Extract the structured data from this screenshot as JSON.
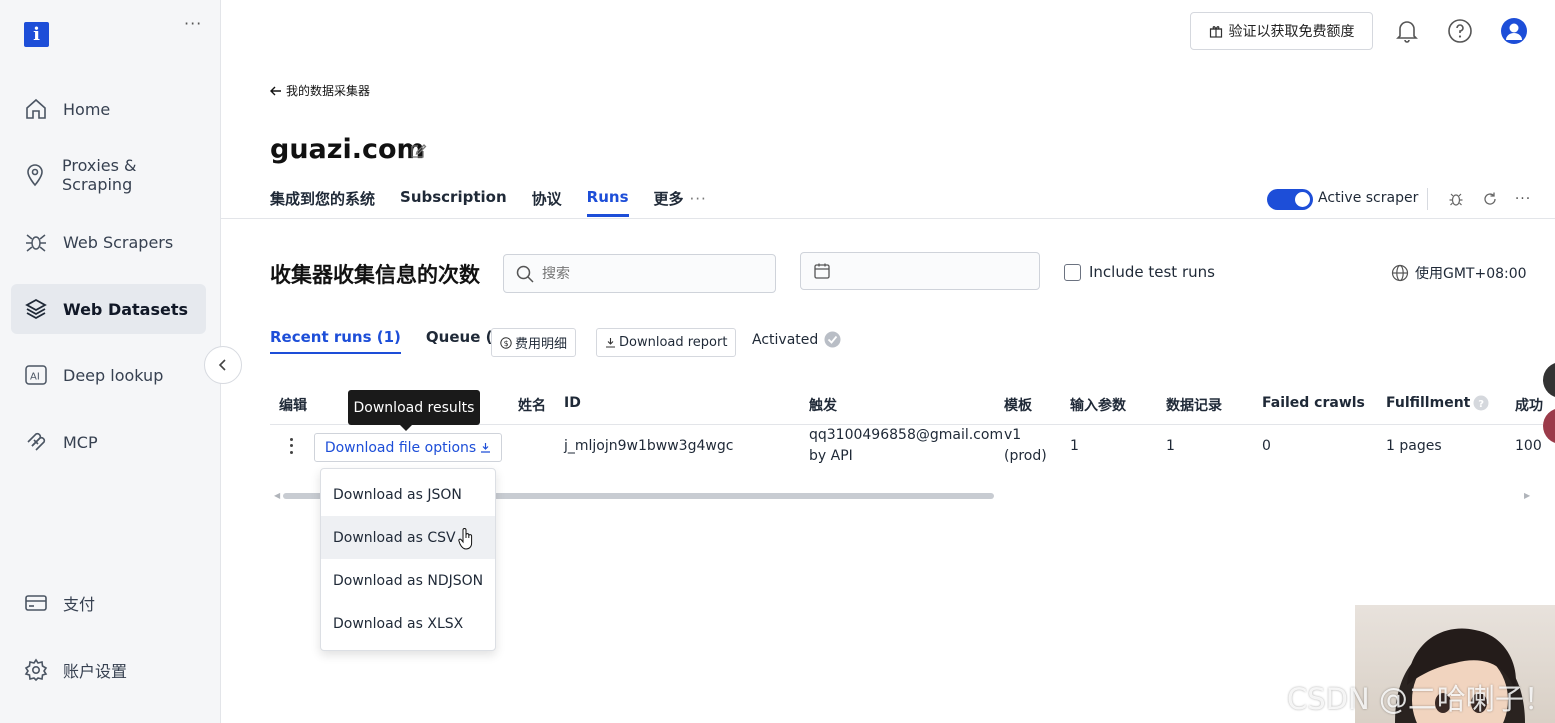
{
  "sidebar": {
    "logo": "i",
    "more": "···",
    "items": [
      {
        "label": "Home",
        "icon": "home-icon"
      },
      {
        "label": "Proxies & Scraping",
        "icon": "location-pin-icon"
      },
      {
        "label": "Web Scrapers",
        "icon": "spider-icon"
      },
      {
        "label": "Web Datasets",
        "icon": "layers-icon",
        "active": true
      },
      {
        "label": "Deep lookup",
        "icon": "ai-icon"
      },
      {
        "label": "MCP",
        "icon": "mcp-icon"
      }
    ],
    "bottom_items": [
      {
        "label": "支付",
        "icon": "card-icon"
      },
      {
        "label": "账户设置",
        "icon": "settings-icon"
      }
    ]
  },
  "header": {
    "verify_button": "验证以获取免费额度"
  },
  "breadcrumb": {
    "back_label": "我的数据采集器"
  },
  "page": {
    "title": "guazi.com"
  },
  "tabs": [
    {
      "label": "集成到您的系统"
    },
    {
      "label": "Subscription"
    },
    {
      "label": "协议"
    },
    {
      "label": "Runs",
      "active": true
    },
    {
      "label": "更多"
    }
  ],
  "scraper_status": {
    "label": "Active scraper",
    "enabled": true
  },
  "runs": {
    "title": "收集器收集信息的次数",
    "search_placeholder": "搜索",
    "include_test_runs": "Include test runs",
    "timezone": "使用GMT+08:00",
    "subtabs": [
      {
        "label": "Recent runs (1)",
        "active": true
      },
      {
        "label": "Queue (0)"
      }
    ],
    "cost_details": "费用明细",
    "download_report": "Download report",
    "activated": "Activated"
  },
  "table": {
    "headers": [
      "编辑",
      "姓名",
      "ID",
      "触发",
      "模板",
      "输入参数",
      "数据记录",
      "Failed crawls",
      "Fulfillment",
      "成功"
    ],
    "row": {
      "download_options": "Download file options",
      "id": "j_mljojn9w1bww3g4wgc",
      "trigger_email": "qq3100496858@gmail.com",
      "trigger_by": "by API",
      "template_version": "v1",
      "template_env": "(prod)",
      "input_params": "1",
      "records": "1",
      "failed_crawls": "0",
      "fulfillment": "1 pages",
      "success": "100"
    }
  },
  "tooltip": "Download results",
  "download_menu": [
    {
      "label": "Download as JSON"
    },
    {
      "label": "Download as CSV",
      "hover": true
    },
    {
      "label": "Download as NDJSON"
    },
    {
      "label": "Download as XLSX"
    }
  ],
  "watermark": "CSDN @二哈喇子！",
  "colors": {
    "accent": "#1d4ed8",
    "sidebar_bg": "#f5f6f8"
  }
}
